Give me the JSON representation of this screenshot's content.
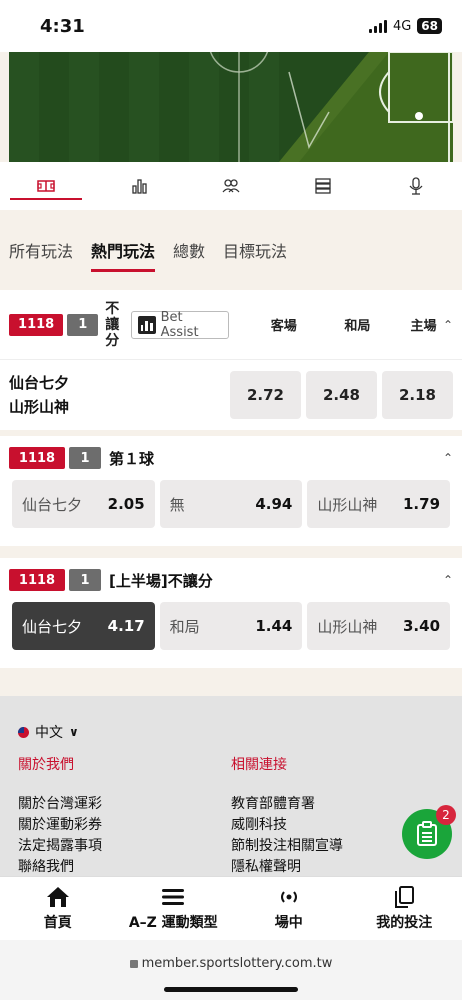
{
  "status": {
    "time": "4:31",
    "network": "4G",
    "battery": "68"
  },
  "icon_tabs": [
    {
      "icon": "field-icon",
      "active": true
    },
    {
      "icon": "stats-icon",
      "active": false
    },
    {
      "icon": "lineup-icon",
      "active": false
    },
    {
      "icon": "list-icon",
      "active": false
    },
    {
      "icon": "microphone-icon",
      "active": false
    }
  ],
  "bet_tabs": [
    "所有玩法",
    "熱門玩法",
    "總數",
    "目標玩法"
  ],
  "market1": {
    "game_id": "1118",
    "game_num": "1",
    "title_chars": [
      "不",
      "讓",
      "分"
    ],
    "assist_label": "Bet Assist",
    "cols": [
      "客場",
      "和局",
      "主場"
    ],
    "team_away": "仙台七夕",
    "team_home": "山形山神",
    "odds": [
      "2.72",
      "2.48",
      "2.18"
    ]
  },
  "market2": {
    "game_id": "1118",
    "game_num": "1",
    "title": "第１球",
    "picks": [
      {
        "label": "仙台七夕",
        "odd": "2.05"
      },
      {
        "label": "無",
        "odd": "4.94"
      },
      {
        "label": "山形山神",
        "odd": "1.79"
      }
    ]
  },
  "market3": {
    "game_id": "1118",
    "game_num": "1",
    "title": "[上半場]不讓分",
    "picks": [
      {
        "label": "仙台七夕",
        "odd": "4.17",
        "selected": true
      },
      {
        "label": "和局",
        "odd": "1.44"
      },
      {
        "label": "山形山神",
        "odd": "3.40"
      }
    ]
  },
  "footer": {
    "language": "中文",
    "about_title": "關於我們",
    "about_links": [
      "關於台灣運彩",
      "關於運動彩券",
      "法定揭露事項",
      "聯絡我們"
    ],
    "related_title": "相關連接",
    "related_links": [
      "教育部體育署",
      "威剛科技",
      "節制投注相關宣導",
      "隱私權聲明"
    ]
  },
  "fab": {
    "badge": "2"
  },
  "bottom_nav": [
    "首頁",
    "A–Z 運動類型",
    "場中",
    "我的投注"
  ],
  "url": "member.sportslottery.com.tw",
  "colors": {
    "accent": "#c8102e",
    "fab": "#1aa53a",
    "pitch": "#2d5f25"
  }
}
